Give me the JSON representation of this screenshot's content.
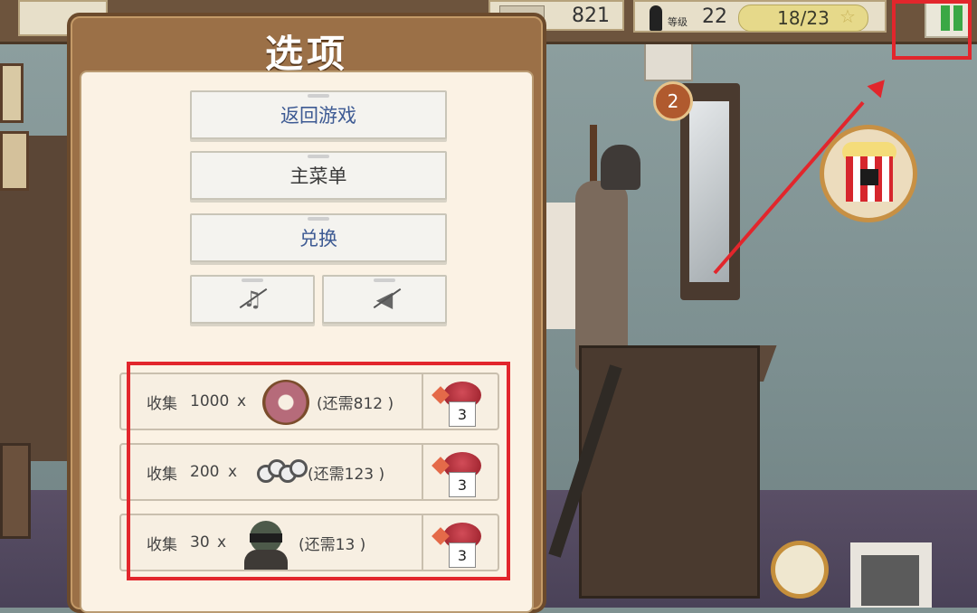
{
  "hud": {
    "coins": "821",
    "level_label": "等级",
    "level_value": "22",
    "progress": "18/23"
  },
  "scene": {
    "notification_count": "2"
  },
  "dialog": {
    "title": "选项",
    "buttons": {
      "resume": "返回游戏",
      "main_menu": "主菜单",
      "redeem": "兑换"
    },
    "tasks": [
      {
        "label": "收集",
        "qty": "1000",
        "x": "x",
        "item": "donut",
        "remaining": "(还需812 )",
        "reward": "3"
      },
      {
        "label": "收集",
        "qty": "200",
        "x": "x",
        "item": "brass-knuckles",
        "remaining": "(还需123 )",
        "reward": "3"
      },
      {
        "label": "收集",
        "qty": "30",
        "x": "x",
        "item": "masked-thief",
        "remaining": "(还需13 )",
        "reward": "3"
      }
    ]
  },
  "colors": {
    "accent_red": "#e2262c",
    "pause_green": "#3aa845",
    "button_text_blue": "#3d5a93"
  }
}
